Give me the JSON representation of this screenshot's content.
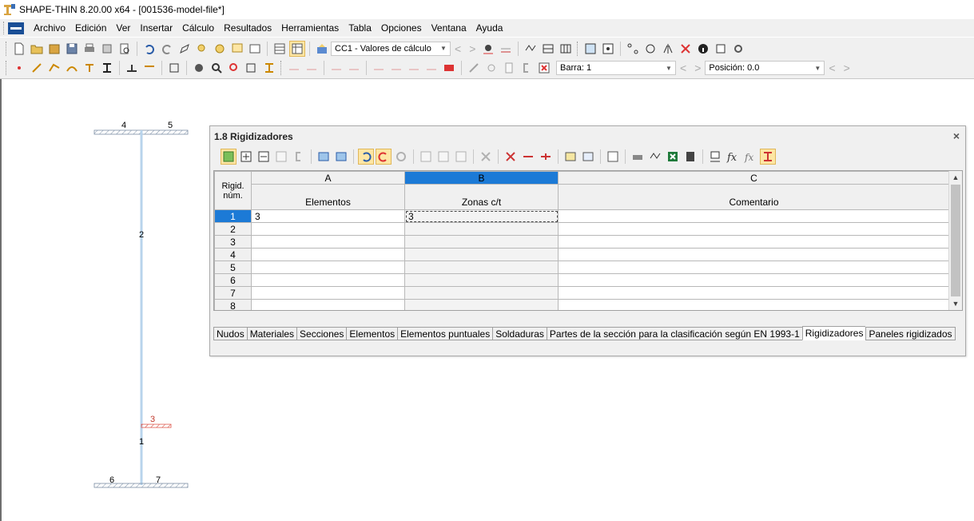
{
  "window": {
    "title": "SHAPE-THIN 8.20.00 x64 - [001536-model-file*]"
  },
  "menu": [
    "Archivo",
    "Edición",
    "Ver",
    "Insertar",
    "Cálculo",
    "Resultados",
    "Herramientas",
    "Tabla",
    "Opciones",
    "Ventana",
    "Ayuda"
  ],
  "toolbar1": {
    "load_case": "CC1 - Valores de cálculo"
  },
  "toolbar2": {
    "bar_combo": "Barra: 1",
    "position_combo": "Posición: 0.0"
  },
  "drawing": {
    "node_labels": [
      "4",
      "5",
      "2",
      "3",
      "1",
      "6",
      "7"
    ],
    "colors": {
      "section_line": "#b8d4ec",
      "stiffener": "#e2574c",
      "hatch": "#7a8da4"
    }
  },
  "panel": {
    "title": "1.8 Rigidizadores",
    "close": "×",
    "corner_header": "Rigid.\nnúm.",
    "columns": [
      {
        "letter": "A",
        "label": "Elementos"
      },
      {
        "letter": "B",
        "label": "Zonas c/t"
      },
      {
        "letter": "C",
        "label": "Comentario"
      }
    ],
    "rows": [
      {
        "num": "1",
        "a": "3",
        "b": "3",
        "c": ""
      },
      {
        "num": "2",
        "a": "",
        "b": "",
        "c": ""
      },
      {
        "num": "3",
        "a": "",
        "b": "",
        "c": ""
      },
      {
        "num": "4",
        "a": "",
        "b": "",
        "c": ""
      },
      {
        "num": "5",
        "a": "",
        "b": "",
        "c": ""
      },
      {
        "num": "6",
        "a": "",
        "b": "",
        "c": ""
      },
      {
        "num": "7",
        "a": "",
        "b": "",
        "c": ""
      },
      {
        "num": "8",
        "a": "",
        "b": "",
        "c": ""
      }
    ],
    "tabs": [
      "Nudos",
      "Materiales",
      "Secciones",
      "Elementos",
      "Elementos puntuales",
      "Soldaduras",
      "Partes de la sección para la clasificación según EN 1993-1",
      "Rigidizadores",
      "Paneles rigidizados"
    ],
    "active_tab": "Rigidizadores"
  }
}
